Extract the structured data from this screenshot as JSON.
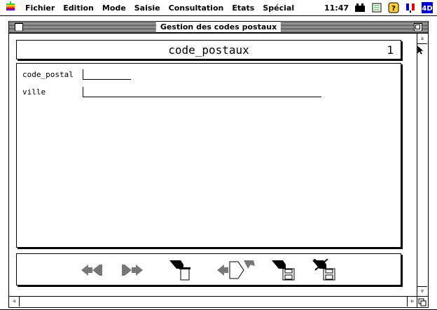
{
  "menubar": {
    "items": [
      "Fichier",
      "Edition",
      "Mode",
      "Saisie",
      "Consultation",
      "Etats",
      "Spécial"
    ],
    "clock": "11:47"
  },
  "window": {
    "title": "Gestion des codes postaux"
  },
  "form": {
    "table_name": "code_postaux",
    "record_number": "1",
    "fields": [
      {
        "label": "code_postal",
        "value": ""
      },
      {
        "label": "ville",
        "value": ""
      }
    ]
  }
}
